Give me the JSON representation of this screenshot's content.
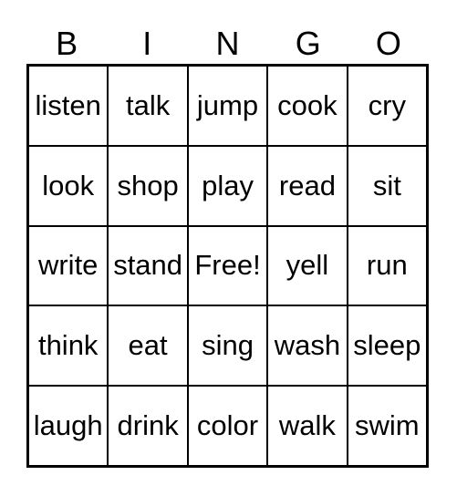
{
  "card": {
    "title": "BINGO",
    "header_letters": [
      "B",
      "I",
      "N",
      "G",
      "O"
    ],
    "free_space_label": "Free!",
    "free_space_position": {
      "row": 2,
      "col": 2
    },
    "grid_size": {
      "rows": 5,
      "cols": 5
    },
    "colors": {
      "background": "#ffffff",
      "text": "#000000",
      "border": "#000000",
      "cell_fill": "#ffffff"
    },
    "rows": [
      {
        "cells": [
          {
            "label": "listen",
            "marked": false
          },
          {
            "label": "talk",
            "marked": false
          },
          {
            "label": "jump",
            "marked": false
          },
          {
            "label": "cook",
            "marked": false
          },
          {
            "label": "cry",
            "marked": false
          }
        ]
      },
      {
        "cells": [
          {
            "label": "look",
            "marked": false
          },
          {
            "label": "shop",
            "marked": false
          },
          {
            "label": "play",
            "marked": false
          },
          {
            "label": "read",
            "marked": false
          },
          {
            "label": "sit",
            "marked": false
          }
        ]
      },
      {
        "cells": [
          {
            "label": "write",
            "marked": false
          },
          {
            "label": "stand",
            "marked": false
          },
          {
            "label": "Free!",
            "marked": false
          },
          {
            "label": "yell",
            "marked": false
          },
          {
            "label": "run",
            "marked": false
          }
        ]
      },
      {
        "cells": [
          {
            "label": "think",
            "marked": false
          },
          {
            "label": "eat",
            "marked": false
          },
          {
            "label": "sing",
            "marked": false
          },
          {
            "label": "wash",
            "marked": false
          },
          {
            "label": "sleep",
            "marked": false
          }
        ]
      },
      {
        "cells": [
          {
            "label": "laugh",
            "marked": false
          },
          {
            "label": "drink",
            "marked": false
          },
          {
            "label": "color",
            "marked": false
          },
          {
            "label": "walk",
            "marked": false
          },
          {
            "label": "swim",
            "marked": false
          }
        ]
      }
    ]
  }
}
